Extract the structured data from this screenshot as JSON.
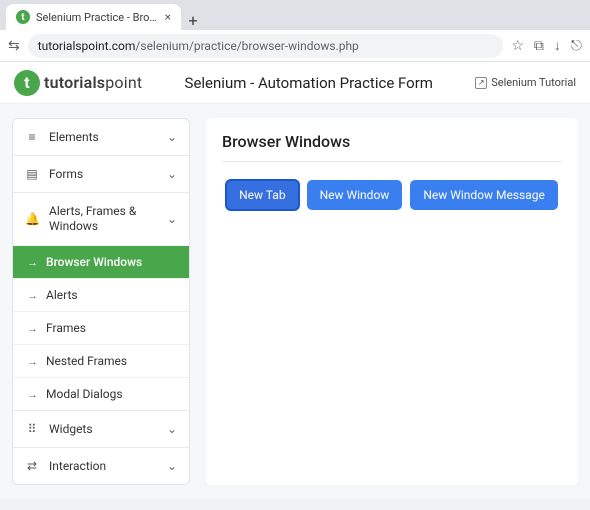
{
  "browser": {
    "tab_title": "Selenium Practice - Browser",
    "url_domain": "tutorialspoint.com",
    "url_path": "/selenium/practice/browser-windows.php"
  },
  "header": {
    "brand_bold": "tutorials",
    "brand_light": "point",
    "title": "Selenium - Automation Practice Form",
    "tutorial_link": "Selenium Tutorial"
  },
  "sidebar": {
    "sections": [
      {
        "icon": "≡",
        "label": "Elements"
      },
      {
        "icon": "▤",
        "label": "Forms"
      },
      {
        "icon": "🔔",
        "label": "Alerts, Frames & Windows"
      },
      {
        "icon": "⠿",
        "label": "Widgets"
      },
      {
        "icon": "⇄",
        "label": "Interaction"
      }
    ],
    "alerts_sub": [
      "Browser Windows",
      "Alerts",
      "Frames",
      "Nested Frames",
      "Modal Dialogs"
    ]
  },
  "content": {
    "heading": "Browser Windows",
    "buttons": {
      "new_tab": "New Tab",
      "new_window": "New Window",
      "new_window_msg": "New Window Message"
    }
  }
}
